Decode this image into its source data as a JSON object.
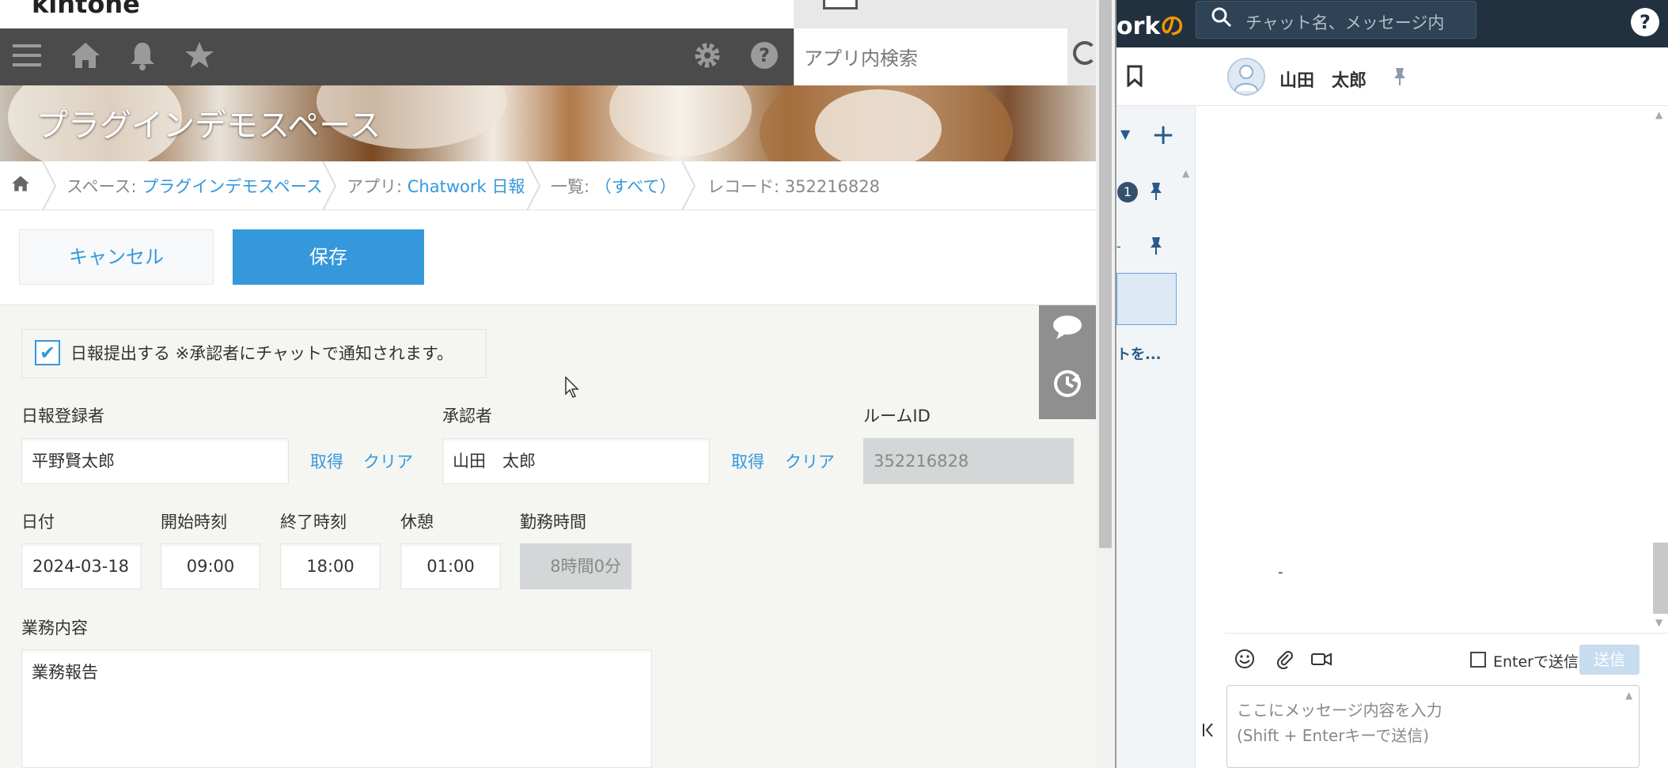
{
  "kintone": {
    "logo": "kintone",
    "search": {
      "placeholder": "アプリ内検索"
    },
    "space_title": "プラグインデモスペース",
    "breadcrumb": {
      "space_prefix": "スペース: ",
      "space_name": "プラグインデモスペース",
      "app_prefix": "アプリ: ",
      "app_name": "Chatwork 日報",
      "list_prefix": "一覧: ",
      "list_name": "（すべて）",
      "record": "レコード: 352216828"
    },
    "actions": {
      "cancel_label": "キャンセル",
      "save_label": "保存"
    },
    "form": {
      "notify_checkbox": {
        "label": "日報提出する ※承認者にチャットで通知されます。",
        "checked": true
      },
      "registrant": {
        "label": "日報登録者",
        "value": "平野賢太郎",
        "get_label": "取得",
        "clear_label": "クリア"
      },
      "approver": {
        "label": "承認者",
        "value": "山田　太郎",
        "get_label": "取得",
        "clear_label": "クリア"
      },
      "room_id": {
        "label": "ルームID",
        "value": "352216828"
      },
      "date": {
        "label": "日付",
        "value": "2024-03-18"
      },
      "start_time": {
        "label": "開始時刻",
        "value": "09:00"
      },
      "end_time": {
        "label": "終了時刻",
        "value": "18:00"
      },
      "break": {
        "label": "休憩",
        "value": "01:00"
      },
      "work_hours": {
        "label": "勤務時間",
        "value": "8時間0分"
      },
      "work_content": {
        "label": "業務内容",
        "value": "業務報告"
      }
    }
  },
  "chatwork": {
    "logo_prefix": "ork",
    "logo_suffix": "の",
    "search": {
      "placeholder": "チャット名、メッセージ内"
    },
    "help": "?",
    "left_panel": {
      "unread_badge": "1",
      "truncated_item": "トを..."
    },
    "room": {
      "name": "山田　太郎"
    },
    "timeline": {
      "dash": "-"
    },
    "composer": {
      "enter_send_label": "Enterで送信",
      "send_label": "送信",
      "placeholder_line1": "ここにメッセージ内容を入力",
      "placeholder_line2": "(Shift + Enterキーで送信)"
    }
  },
  "colors": {
    "kintone_blue": "#3498db",
    "kintone_nav": "#4b4b4b",
    "chatwork_header": "#22313f",
    "chatwork_orange": "#f39800"
  }
}
